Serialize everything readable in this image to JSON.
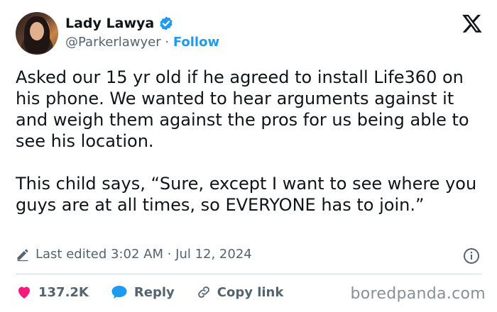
{
  "author": {
    "name": "Lady Lawya",
    "handle": "@Parkerlawyer",
    "separator": "·",
    "follow_label": "Follow"
  },
  "tweet": {
    "text": "Asked our 15 yr old if he agreed to install Life360 on his phone. We wanted to hear arguments against it and weigh them against the pros for us being able to see his location.\n\nThis child says, “Sure, except I want to see where you guys are at all times, so EVERYONE has to join.”"
  },
  "meta": {
    "edited_text": "Last edited 3:02 AM · Jul 12, 2024"
  },
  "actions": {
    "likes": "137.2K",
    "reply_label": "Reply",
    "copy_link_label": "Copy link"
  },
  "watermark": "boredpanda.com",
  "icons": [
    "verified-badge-icon",
    "x-logo-icon",
    "edit-pencil-icon",
    "info-icon",
    "heart-icon",
    "reply-bubble-icon",
    "link-icon"
  ],
  "colors": {
    "accent": "#1d9bf0",
    "like": "#f91880",
    "muted": "#536471",
    "text": "#0f1419"
  }
}
